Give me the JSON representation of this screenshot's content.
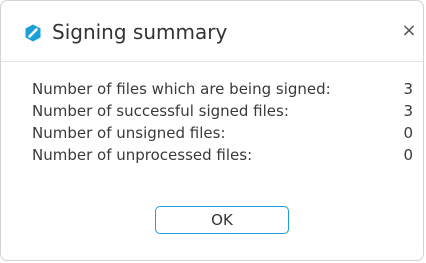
{
  "dialog": {
    "title": "Signing summary",
    "close_glyph": "×",
    "icon": "app-logo-icon",
    "accent_color": "#1a9fd8"
  },
  "summary": {
    "rows": [
      {
        "label": "Number of files which are being signed:",
        "value": "3"
      },
      {
        "label": "Number of successful signed files:",
        "value": "3"
      },
      {
        "label": "Number of unsigned files:",
        "value": "0"
      },
      {
        "label": "Number of unprocessed files:",
        "value": "0"
      }
    ]
  },
  "actions": {
    "ok_label": "OK"
  }
}
